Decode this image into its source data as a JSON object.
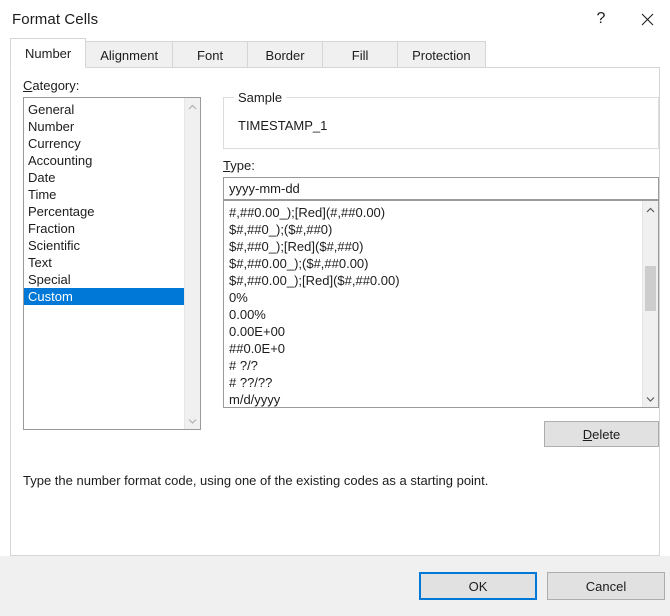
{
  "window": {
    "title": "Format Cells",
    "help_icon": "help-question-icon",
    "help_glyph": "?",
    "close_icon": "close-x-icon"
  },
  "tabs": [
    {
      "label": "Number",
      "active": true
    },
    {
      "label": "Alignment",
      "active": false
    },
    {
      "label": "Font",
      "active": false
    },
    {
      "label": "Border",
      "active": false
    },
    {
      "label": "Fill",
      "active": false
    },
    {
      "label": "Protection",
      "active": false
    }
  ],
  "category": {
    "label_prefix": "C",
    "label_rest": "ategory:",
    "items": [
      "General",
      "Number",
      "Currency",
      "Accounting",
      "Date",
      "Time",
      "Percentage",
      "Fraction",
      "Scientific",
      "Text",
      "Special",
      "Custom"
    ],
    "selected": "Custom",
    "selected_index": 11,
    "scrollbar": {
      "up_icon": "chevron-up-icon",
      "down_icon": "chevron-down-icon",
      "thumb_visible": false
    }
  },
  "sample": {
    "legend": "Sample",
    "value": "TIMESTAMP_1"
  },
  "type": {
    "label_prefix": "T",
    "label_rest": "ype:",
    "input_value": "yyyy-mm-dd",
    "items": [
      "#,##0.00_);[Red](#,##0.00)",
      "$#,##0_);($#,##0)",
      "$#,##0_);[Red]($#,##0)",
      "$#,##0.00_);($#,##0.00)",
      "$#,##0.00_);[Red]($#,##0.00)",
      "0%",
      "0.00%",
      "0.00E+00",
      "##0.0E+0",
      "# ?/?",
      "# ??/??",
      "m/d/yyyy"
    ],
    "scrollbar": {
      "up_icon": "chevron-up-icon",
      "down_icon": "chevron-down-icon",
      "thumb_visible": true,
      "thumb_top_pct": 28,
      "thumb_height_pct": 26
    }
  },
  "delete_button": {
    "label_prefix": "D",
    "label_rest": "elete"
  },
  "help_text": "Type the number format code, using one of the existing codes as a starting point.",
  "footer": {
    "ok_label": "OK",
    "cancel_label": "Cancel"
  },
  "colors": {
    "selection_blue": "#0078D7",
    "dialog_bg": "#FFFFFF",
    "footer_bg": "#F0F0F0",
    "button_face": "#E1E1E1"
  }
}
